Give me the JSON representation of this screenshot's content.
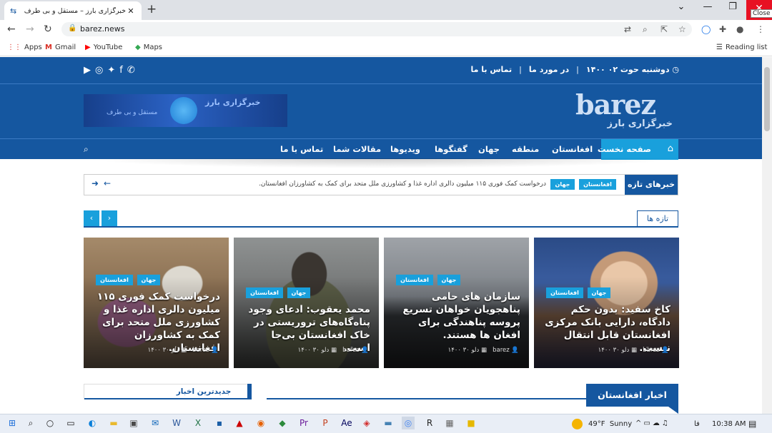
{
  "browser": {
    "tab_title": "خبرگزاری بارز – مستقل و بی طرف",
    "new_tab": "+",
    "close_tooltip": "Close",
    "url": "barez.news",
    "bookmarks": [
      {
        "label": "Apps",
        "icon": "apps-grid-icon"
      },
      {
        "label": "Gmail",
        "icon": "gmail-icon"
      },
      {
        "label": "YouTube",
        "icon": "youtube-icon"
      },
      {
        "label": "Maps",
        "icon": "maps-icon"
      }
    ],
    "reading_list": "Reading list"
  },
  "site": {
    "topbar": {
      "date": "دوشنبه حوت ۰۲ ۱۴۰۰",
      "about": "در مورد ما",
      "contact": "تماس با ما"
    },
    "logo_latin": "barez",
    "logo_persian": "خبرگزاری بارز",
    "banner_title": "خبرگزاری بارز",
    "banner_sub": "مستقل و بی طرف",
    "nav": {
      "home": "صفحه نخست",
      "items": [
        "افغانستان",
        "منطقه",
        "جهان",
        "گفتگوها",
        "ویدیوها",
        "مقالات شما",
        "تماس با ما"
      ]
    },
    "breaking": {
      "label": "خبرهای تازه",
      "tag1": "افغانستان",
      "tag2": "جهان",
      "text": "درخواست کمک فوری ۱۱۵ میلیون دالری اداره غذا و کشاورزی ملل متحد برای کمک به کشاورزان افغانستان."
    },
    "section_new": "تازه ها",
    "cards": [
      {
        "tag1": "افغانستان",
        "tag2": "جهان",
        "title": "کاخ سفید: بدون حکم دادگاه، دارایی بانک مرکزی افغانستان قابل انتقال نیست.",
        "author": "barez",
        "date": "دلو ۳۰ ۱۴۰۰"
      },
      {
        "tag1": "افغانستان",
        "tag2": "جهان",
        "title": "سازمان های حامی پناهجویان خواهان تسریع پروسه پناهندگی برای افغان ها هستند.",
        "author": "barez",
        "date": "دلو ۳۰ ۱۴۰۰"
      },
      {
        "tag1": "افغانستان",
        "tag2": "جهان",
        "title": "محمد یعقوب: ادعای وجود پناه‌گاه‌های تروریستی در خاک افغانستان بی‌جا است.",
        "author": "barez",
        "date": "دلو ۳۰ ۱۴۰۰"
      },
      {
        "tag1": "افغانستان",
        "tag2": "جهان",
        "title": "درخواست کمک فوری ۱۱۵ میلیون دالری اداره غذا و کشاورزی ملل متحد برای کمک به کشاورزان افغانستان.",
        "author": "barez",
        "date": "دلو ۳۰ ۱۴۰۰"
      }
    ],
    "section_afg": "اخبار افغانستان",
    "section_latest": "جدیدترین اخبار"
  },
  "taskbar": {
    "weather": "49°F  Sunny",
    "lang": "فا",
    "time": "10:38 AM"
  },
  "colors": {
    "brand": "#1557a0",
    "accent": "#19a0dc"
  }
}
